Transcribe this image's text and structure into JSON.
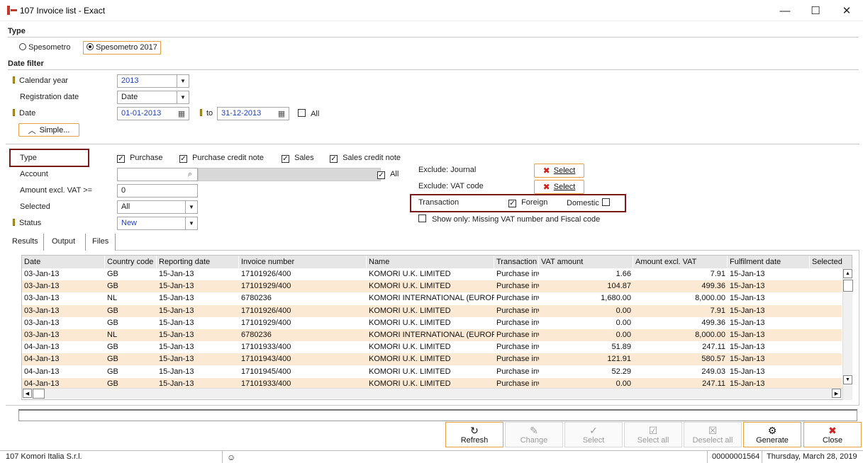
{
  "window": {
    "title": "107 Invoice list - Exact",
    "minimize": "—",
    "maximize": "☐",
    "close": "✕"
  },
  "type_section": {
    "header": "Type",
    "options": [
      {
        "label": "Spesometro",
        "selected": false
      },
      {
        "label": "Spesometro 2017",
        "selected": true
      }
    ]
  },
  "date_filter": {
    "header": "Date filter",
    "calendar_year_label": "Calendar year",
    "calendar_year_value": "2013",
    "registration_date_label": "Registration date",
    "registration_date_value": "Date",
    "date_label": "Date",
    "date_from": "01-01-2013",
    "to_label": "to",
    "date_to": "31-12-2013",
    "all_label": "All",
    "simple_button": "Simple..."
  },
  "filters": {
    "type_label": "Type",
    "type_checks": [
      {
        "label": "Purchase",
        "checked": true
      },
      {
        "label": "Purchase credit note",
        "checked": true
      },
      {
        "label": "Sales",
        "checked": true
      },
      {
        "label": "Sales credit note",
        "checked": true
      }
    ],
    "account_label": "Account",
    "account_all_label": "All",
    "amount_label": "Amount excl. VAT >=",
    "amount_value": "0",
    "selected_label": "Selected",
    "selected_value": "All",
    "status_label": "Status",
    "status_value": "New",
    "exclude_journal_label": "Exclude: Journal",
    "exclude_vat_label": "Exclude: VAT code",
    "select_button": "Select",
    "transaction_label": "Transaction",
    "foreign_label": "Foreign",
    "domestic_label": "Domestic",
    "show_only_label": "Show only: Missing VAT number and Fiscal code"
  },
  "tabs": [
    "Results",
    "Output",
    "Files"
  ],
  "grid": {
    "columns": [
      "Date",
      "Country code",
      "Reporting date",
      "Invoice number",
      "Name",
      "Transaction",
      "VAT amount",
      "Amount excl. VAT",
      "Fulfilment date",
      "Selected"
    ],
    "rows": [
      [
        "03-Jan-13",
        "GB",
        "15-Jan-13",
        "17101926/400",
        "KOMORI U.K. LIMITED",
        "Purchase inv",
        "1.66",
        "7.91",
        "15-Jan-13",
        ""
      ],
      [
        "03-Jan-13",
        "GB",
        "15-Jan-13",
        "17101929/400",
        "KOMORI U.K. LIMITED",
        "Purchase inv",
        "104.87",
        "499.36",
        "15-Jan-13",
        ""
      ],
      [
        "03-Jan-13",
        "NL",
        "15-Jan-13",
        "6780236",
        "KOMORI INTERNATIONAL (EUROPE)",
        "Purchase inv",
        "1,680.00",
        "8,000.00",
        "15-Jan-13",
        ""
      ],
      [
        "03-Jan-13",
        "GB",
        "15-Jan-13",
        "17101926/400",
        "KOMORI U.K. LIMITED",
        "Purchase inv",
        "0.00",
        "7.91",
        "15-Jan-13",
        ""
      ],
      [
        "03-Jan-13",
        "GB",
        "15-Jan-13",
        "17101929/400",
        "KOMORI U.K. LIMITED",
        "Purchase inv",
        "0.00",
        "499.36",
        "15-Jan-13",
        ""
      ],
      [
        "03-Jan-13",
        "NL",
        "15-Jan-13",
        "6780236",
        "KOMORI INTERNATIONAL (EUROPE)",
        "Purchase inv",
        "0.00",
        "8,000.00",
        "15-Jan-13",
        ""
      ],
      [
        "04-Jan-13",
        "GB",
        "15-Jan-13",
        "17101933/400",
        "KOMORI U.K. LIMITED",
        "Purchase inv",
        "51.89",
        "247.11",
        "15-Jan-13",
        ""
      ],
      [
        "04-Jan-13",
        "GB",
        "15-Jan-13",
        "17101943/400",
        "KOMORI U.K. LIMITED",
        "Purchase inv",
        "121.91",
        "580.57",
        "15-Jan-13",
        ""
      ],
      [
        "04-Jan-13",
        "GB",
        "15-Jan-13",
        "17101945/400",
        "KOMORI U.K. LIMITED",
        "Purchase inv",
        "52.29",
        "249.03",
        "15-Jan-13",
        ""
      ],
      [
        "04-Jan-13",
        "GB",
        "15-Jan-13",
        "17101933/400",
        "KOMORI U.K. LIMITED",
        "Purchase inv",
        "0.00",
        "247.11",
        "15-Jan-13",
        ""
      ]
    ]
  },
  "toolbar": {
    "refresh": "Refresh",
    "change": "Change",
    "select": "Select",
    "select_all": "Select all",
    "deselect_all": "Deselect all",
    "generate": "Generate",
    "close": "Close"
  },
  "statusbar": {
    "company": "107 Komori Italia S.r.l.",
    "record": "00000001564",
    "date": "Thursday, March 28, 2019"
  }
}
